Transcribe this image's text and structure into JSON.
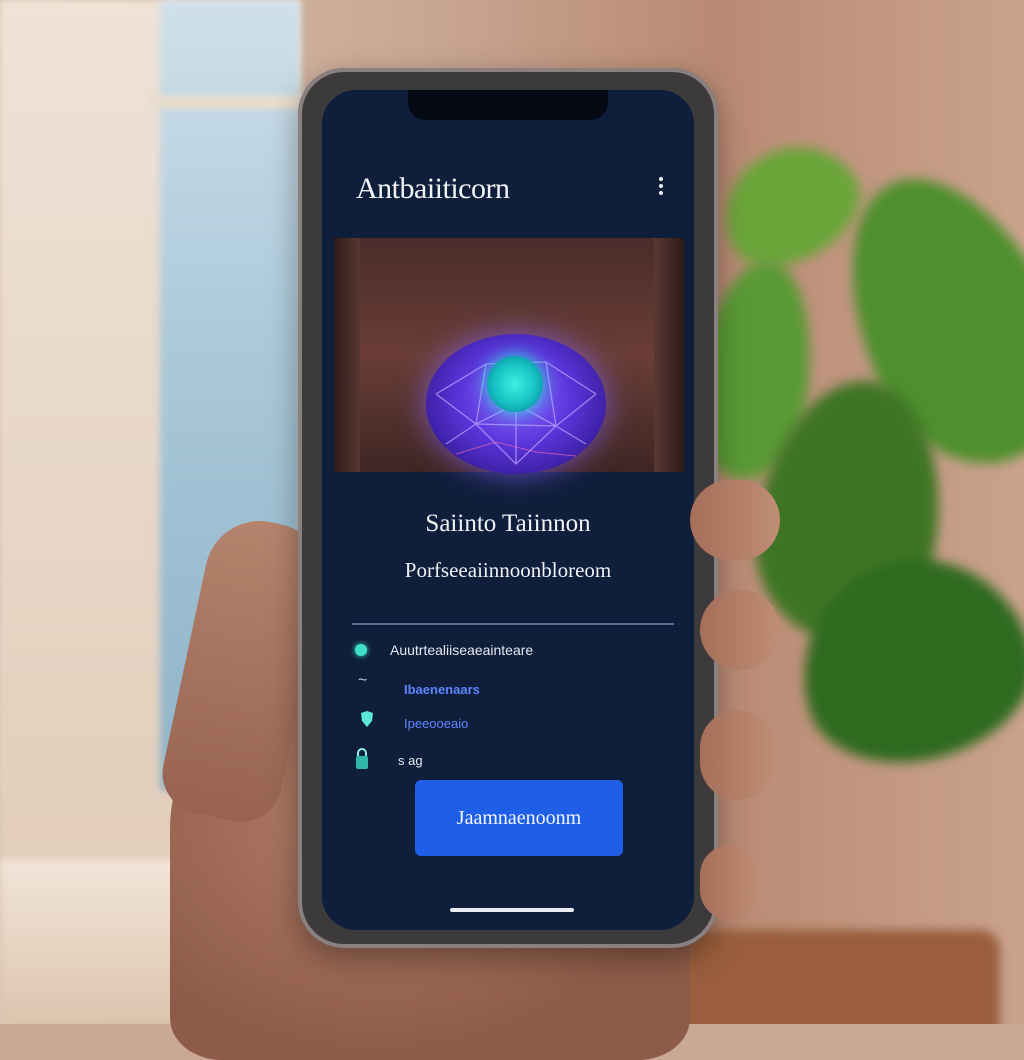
{
  "app": {
    "title": "Antbaiiticorn"
  },
  "hero": {
    "icon": "glowing-orb-icon"
  },
  "content": {
    "headline": "Saiinto Taiinnon",
    "subline": "Porfseeaiinnoonbloreom"
  },
  "features": [
    {
      "icon": "teal-dot-icon",
      "label": "Auutrtealiiseaeainteare",
      "color": "#e6e8ef"
    },
    {
      "icon": "tilde-icon",
      "label": "Ibaenenaars",
      "color": "#5d86ff"
    },
    {
      "icon": "shield-icon",
      "label": "Ipeeooeaio",
      "color": "#5d86ff"
    },
    {
      "icon": "lock-icon",
      "label": "s ag",
      "color": "#e6e8ef"
    }
  ],
  "cta": {
    "label": "Jaamnaenoonm",
    "color": "#1f5fe8"
  },
  "colors": {
    "screen_bg": "#0f1e3a",
    "accent": "#1f5fe8",
    "orb": "#5a33d8",
    "orb_core": "#29e6e0"
  }
}
